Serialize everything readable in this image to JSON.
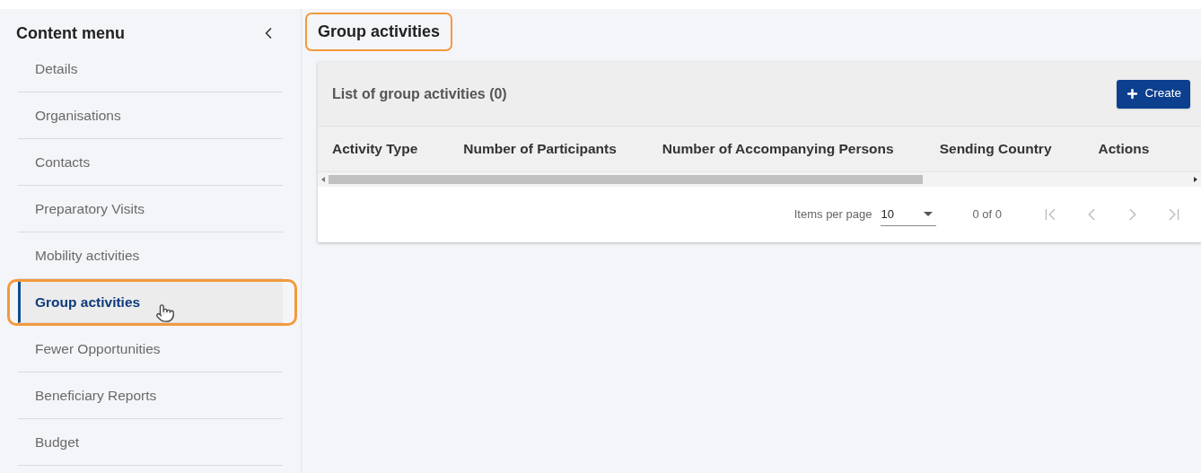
{
  "sidebar": {
    "title": "Content menu",
    "items": [
      {
        "label": "Details",
        "selected": false
      },
      {
        "label": "Organisations",
        "selected": false
      },
      {
        "label": "Contacts",
        "selected": false
      },
      {
        "label": "Preparatory Visits",
        "selected": false
      },
      {
        "label": "Mobility activities",
        "selected": false
      },
      {
        "label": "Group activities",
        "selected": true,
        "highlighted": true
      },
      {
        "label": "Fewer Opportunities",
        "selected": false
      },
      {
        "label": "Beneficiary Reports",
        "selected": false
      },
      {
        "label": "Budget",
        "selected": false
      }
    ]
  },
  "page_title": {
    "text": "Group activities",
    "highlighted": true
  },
  "table": {
    "title": "List of group activities (0)",
    "create_button": "Create",
    "columns": [
      "Activity Type",
      "Number of Participants",
      "Number of Accompanying Persons",
      "Sending Country",
      "Actions"
    ]
  },
  "paginator": {
    "items_per_page_label": "Items per page",
    "items_per_page": "10",
    "range": "0 of 0",
    "buttons": [
      {
        "kind": "first",
        "disabled": true
      },
      {
        "kind": "previous",
        "disabled": true
      },
      {
        "kind": "next",
        "disabled": true
      },
      {
        "kind": "last",
        "disabled": true
      }
    ]
  }
}
